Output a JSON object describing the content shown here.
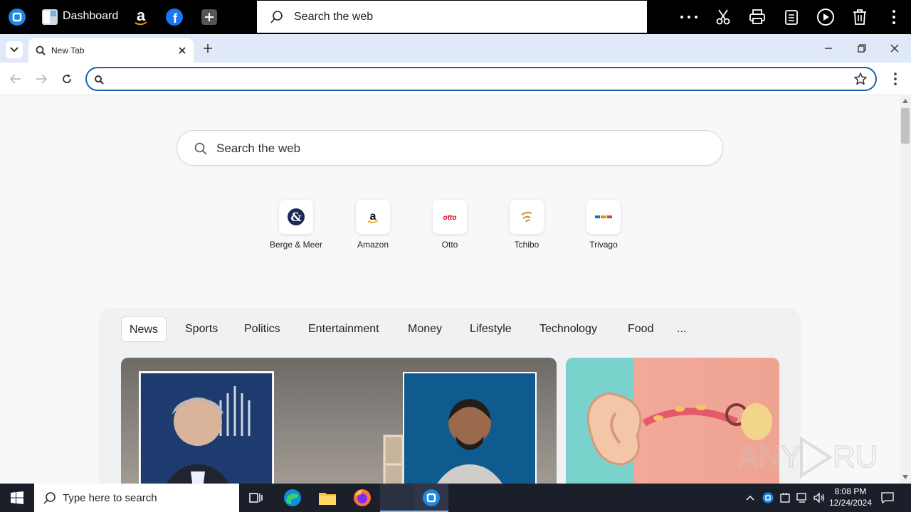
{
  "topbar": {
    "dashboard_label": "Dashboard",
    "search_placeholder": "Search the web"
  },
  "browser": {
    "tab_title": "New Tab",
    "address_value": ""
  },
  "page": {
    "search_placeholder": "Search the web",
    "top_sites": [
      {
        "label": "Berge & Meer"
      },
      {
        "label": "Amazon"
      },
      {
        "label": "Otto"
      },
      {
        "label": "Tchibo"
      },
      {
        "label": "Trivago"
      }
    ],
    "categories": [
      "News",
      "Sports",
      "Politics",
      "Entertainment",
      "Money",
      "Lifestyle",
      "Technology",
      "Food",
      "..."
    ],
    "active_category": "News"
  },
  "taskbar": {
    "search_placeholder": "Type here to search",
    "time": "8:08 PM",
    "date": "12/24/2024"
  },
  "colors": {
    "accent": "#1a5fb4",
    "tabstrip": "#dfe9f8"
  }
}
